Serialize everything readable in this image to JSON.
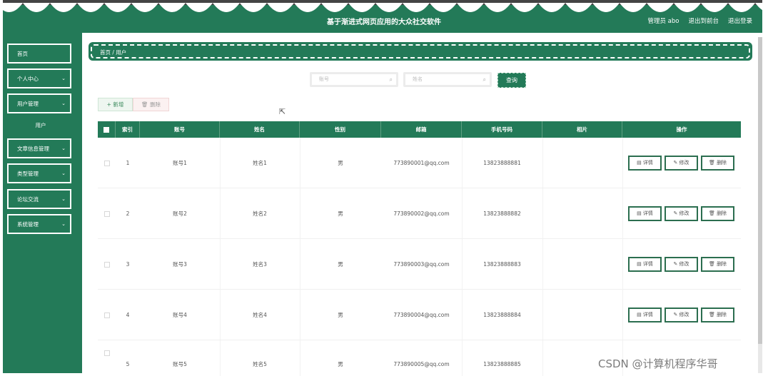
{
  "header": {
    "title": "基于渐进式网页应用的大众社交软件",
    "admin_label": "管理员 abo",
    "back_label": "退出到前台",
    "logout_label": "退出登录"
  },
  "sidebar": {
    "items": [
      {
        "label": "首页"
      },
      {
        "label": "个人中心"
      },
      {
        "label": "用户管理"
      },
      {
        "label": "文章信息管理"
      },
      {
        "label": "类型管理"
      },
      {
        "label": "论坛交流"
      },
      {
        "label": "系统管理"
      }
    ],
    "sub_item": "用户"
  },
  "breadcrumb": "首页 / 用户",
  "search": {
    "account_placeholder": "账号",
    "name_placeholder": "姓名",
    "button": "查询"
  },
  "toolbar": {
    "add_label": "+ 新增",
    "delete_label": "🗑 删除"
  },
  "table": {
    "headers": [
      "索引",
      "账号",
      "姓名",
      "性别",
      "邮箱",
      "手机号码",
      "相片",
      "操作"
    ],
    "rows": [
      {
        "index": "1",
        "account": "账号1",
        "name": "姓名1",
        "gender": "男",
        "email": "773890001@qq.com",
        "phone": "13823888881"
      },
      {
        "index": "2",
        "account": "账号2",
        "name": "姓名2",
        "gender": "男",
        "email": "773890002@qq.com",
        "phone": "13823888882"
      },
      {
        "index": "3",
        "account": "账号3",
        "name": "姓名3",
        "gender": "男",
        "email": "773890003@qq.com",
        "phone": "13823888883"
      },
      {
        "index": "4",
        "account": "账号4",
        "name": "姓名4",
        "gender": "男",
        "email": "773890004@qq.com",
        "phone": "13823888884"
      },
      {
        "index": "5",
        "account": "账号5",
        "name": "姓名5",
        "gender": "男",
        "email": "773890005@qq.com",
        "phone": "13823888885"
      }
    ],
    "actions": {
      "detail": "详情",
      "edit": "修改",
      "delete": "删除"
    }
  },
  "watermark": "CSDN @计算机程序华哥",
  "colors": {
    "primary": "#237a58",
    "white": "#ffffff"
  }
}
